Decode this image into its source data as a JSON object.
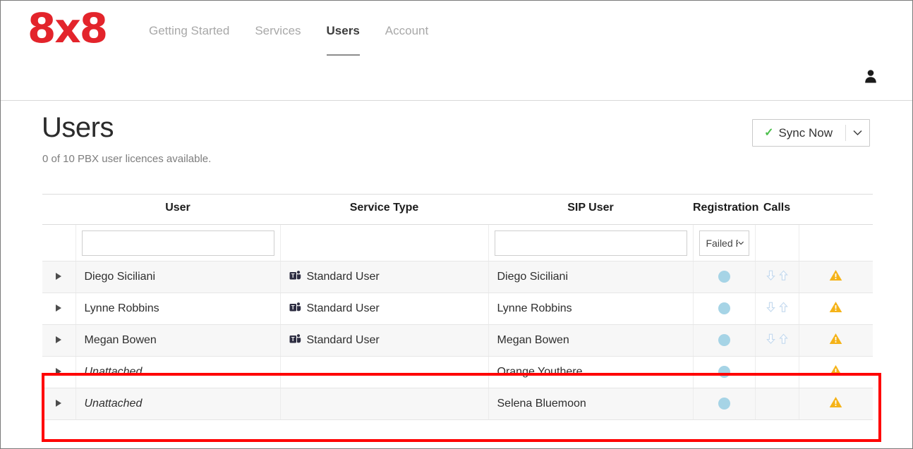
{
  "brand": {
    "logo_text": "8x8"
  },
  "nav": {
    "items": [
      {
        "label": "Getting Started",
        "active": false
      },
      {
        "label": "Services",
        "active": false
      },
      {
        "label": "Users",
        "active": true
      },
      {
        "label": "Account",
        "active": false
      }
    ],
    "account_icon": "user-account-icon"
  },
  "header": {
    "title": "Users",
    "subtitle": "0 of 10 PBX user licences available.",
    "sync_button": {
      "label": "Sync Now",
      "check_icon": "check-icon",
      "check_color": "#4cbf4c",
      "caret_icon": "chevron-down-icon"
    }
  },
  "table": {
    "columns": [
      {
        "key": "expand",
        "label": ""
      },
      {
        "key": "user",
        "label": "User"
      },
      {
        "key": "service_type",
        "label": "Service Type"
      },
      {
        "key": "sip_user",
        "label": "SIP User"
      },
      {
        "key": "registration",
        "label": "Registration"
      },
      {
        "key": "calls",
        "label": "Calls"
      },
      {
        "key": "warning",
        "label": ""
      }
    ],
    "filters": {
      "user_value": "",
      "user_placeholder": "",
      "sip_user_value": "",
      "sip_user_placeholder": "",
      "registration_value": "Failed Re",
      "registration_caret": "chevron-down-icon"
    },
    "rows": [
      {
        "expand_icon": "expand-triangle-icon",
        "user": "Diego Siciliani",
        "user_italic": false,
        "service_icon": "microsoft-teams-icon",
        "service_type": "Standard User",
        "sip_user": "Diego Siciliani",
        "registration_icon": "registration-status-dot",
        "registration_color": "#a6d4e6",
        "calls_icons": [
          "call-down-arrow-icon",
          "call-up-arrow-icon"
        ],
        "warning_icon": "warning-triangle-icon",
        "warning_color": "#f5b318",
        "highlighted": false
      },
      {
        "expand_icon": "expand-triangle-icon",
        "user": "Lynne Robbins",
        "user_italic": false,
        "service_icon": "microsoft-teams-icon",
        "service_type": "Standard User",
        "sip_user": "Lynne Robbins",
        "registration_icon": "registration-status-dot",
        "registration_color": "#a6d4e6",
        "calls_icons": [
          "call-down-arrow-icon",
          "call-up-arrow-icon"
        ],
        "warning_icon": "warning-triangle-icon",
        "warning_color": "#f5b318",
        "highlighted": false
      },
      {
        "expand_icon": "expand-triangle-icon",
        "user": "Megan Bowen",
        "user_italic": false,
        "service_icon": "microsoft-teams-icon",
        "service_type": "Standard User",
        "sip_user": "Megan Bowen",
        "registration_icon": "registration-status-dot",
        "registration_color": "#a6d4e6",
        "calls_icons": [
          "call-down-arrow-icon",
          "call-up-arrow-icon"
        ],
        "warning_icon": "warning-triangle-icon",
        "warning_color": "#f5b318",
        "highlighted": false
      },
      {
        "expand_icon": "expand-triangle-icon",
        "user": "Unattached",
        "user_italic": true,
        "service_icon": "",
        "service_type": "",
        "sip_user": "Orange Youthere",
        "registration_icon": "registration-status-dot",
        "registration_color": "#a6d4e6",
        "calls_icons": [],
        "warning_icon": "warning-triangle-icon",
        "warning_color": "#f5b318",
        "highlighted": true
      },
      {
        "expand_icon": "expand-triangle-icon",
        "user": "Unattached",
        "user_italic": true,
        "service_icon": "",
        "service_type": "",
        "sip_user": "Selena Bluemoon",
        "registration_icon": "registration-status-dot",
        "registration_color": "#a6d4e6",
        "calls_icons": [],
        "warning_icon": "warning-triangle-icon",
        "warning_color": "#f5b318",
        "highlighted": true
      }
    ]
  },
  "annotation": {
    "highlight_box_color": "#ff0000"
  }
}
